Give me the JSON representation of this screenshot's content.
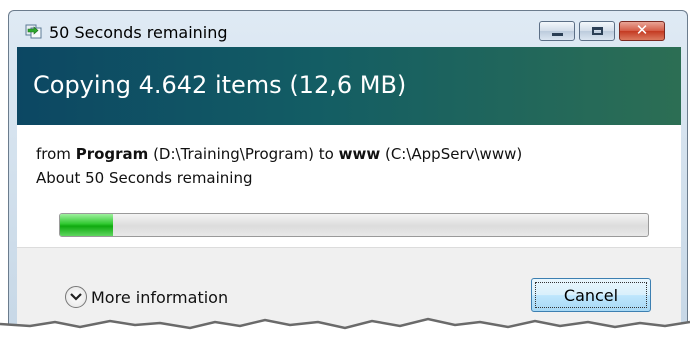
{
  "window": {
    "title": "50 Seconds remaining",
    "icon": "copy-files-icon",
    "controls": [
      "minimize-icon",
      "maximize-icon",
      "close-icon"
    ],
    "close_glyph": "✕"
  },
  "header": {
    "title": "Copying 4.642 items (12,6 MB)"
  },
  "details": {
    "from_word": "from",
    "source_name": "Program",
    "source_path": "(D:\\Training\\Program)",
    "to_word": "to",
    "dest_name": "www",
    "dest_path": "(C:\\AppServ\\www)",
    "time_remaining": "About 50 Seconds remaining"
  },
  "progress": {
    "value_percent": 9
  },
  "footer": {
    "more_info_label": "More information",
    "cancel_label": "Cancel"
  },
  "colors": {
    "header_start": "#0c4763",
    "header_end": "#2c6e54",
    "progress_fill": "#1fbf1f"
  }
}
